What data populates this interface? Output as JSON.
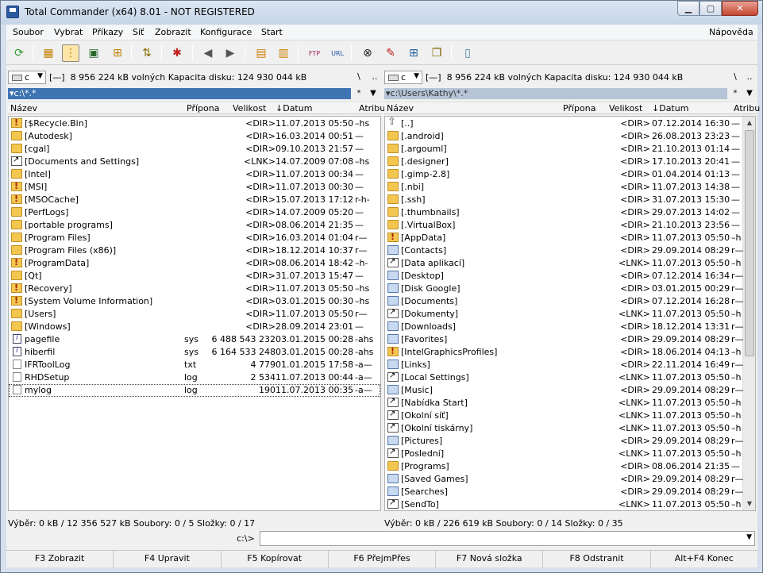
{
  "window": {
    "title": "Total Commander (x64) 8.01 - NOT REGISTERED"
  },
  "menu": [
    "Soubor",
    "Vybrat",
    "Příkazy",
    "Síť",
    "Zobrazit",
    "Konfigurace",
    "Start"
  ],
  "menu_help": "Nápověda",
  "toolbar_icons": [
    "refresh-icon",
    "brief-view-icon",
    "full-view-icon",
    "thumbnails-view-icon",
    "tree-view-icon",
    "invert-selection-icon",
    "compare-dirs-icon",
    "back-icon",
    "forward-icon",
    "pack-icon",
    "unpack-icon",
    "ftp-connect-icon",
    "url-connect-icon",
    "find-files-icon",
    "multi-rename-icon",
    "sync-dirs-icon",
    "copy-names-icon",
    "notepad-icon"
  ],
  "left": {
    "drive": "c",
    "drive_label": "[—]",
    "drive_info": "8 956 224 kB volných  Kapacita disku: 124 930 044 kB",
    "path": "c:\\*.*",
    "columns": {
      "name": "Název",
      "ext": "Přípona",
      "size": "Velikost",
      "date": "Datum",
      "attr": "Atribu"
    },
    "files": [
      {
        "icon": "folder-excl",
        "name": "[$Recycle.Bin]",
        "ext": "",
        "size": "<DIR>",
        "date": "11.07.2013 05:50",
        "attr": "–hs"
      },
      {
        "icon": "folder",
        "name": "[Autodesk]",
        "ext": "",
        "size": "<DIR>",
        "date": "16.03.2014 00:51",
        "attr": "—"
      },
      {
        "icon": "folder",
        "name": "[cgal]",
        "ext": "",
        "size": "<DIR>",
        "date": "09.10.2013 21:57",
        "attr": "—"
      },
      {
        "icon": "lnk",
        "name": "[Documents and Settings]",
        "ext": "",
        "size": "<LNK>",
        "date": "14.07.2009 07:08",
        "attr": "–hs"
      },
      {
        "icon": "folder",
        "name": "[Intel]",
        "ext": "",
        "size": "<DIR>",
        "date": "11.07.2013 00:34",
        "attr": "—"
      },
      {
        "icon": "folder-excl",
        "name": "[MSI]",
        "ext": "",
        "size": "<DIR>",
        "date": "11.07.2013 00:30",
        "attr": "—"
      },
      {
        "icon": "folder-excl",
        "name": "[MSOCache]",
        "ext": "",
        "size": "<DIR>",
        "date": "15.07.2013 17:12",
        "attr": "r-h-"
      },
      {
        "icon": "folder",
        "name": "[PerfLogs]",
        "ext": "",
        "size": "<DIR>",
        "date": "14.07.2009 05:20",
        "attr": "—"
      },
      {
        "icon": "folder",
        "name": "[portable programs]",
        "ext": "",
        "size": "<DIR>",
        "date": "08.06.2014 21:35",
        "attr": "—"
      },
      {
        "icon": "folder",
        "name": "[Program Files]",
        "ext": "",
        "size": "<DIR>",
        "date": "16.03.2014 01:04",
        "attr": "r—"
      },
      {
        "icon": "folder",
        "name": "[Program Files (x86)]",
        "ext": "",
        "size": "<DIR>",
        "date": "18.12.2014 10:37",
        "attr": "r—"
      },
      {
        "icon": "folder-excl",
        "name": "[ProgramData]",
        "ext": "",
        "size": "<DIR>",
        "date": "08.06.2014 18:42",
        "attr": "–h-"
      },
      {
        "icon": "folder",
        "name": "[Qt]",
        "ext": "",
        "size": "<DIR>",
        "date": "31.07.2013 15:47",
        "attr": "—"
      },
      {
        "icon": "folder-excl",
        "name": "[Recovery]",
        "ext": "",
        "size": "<DIR>",
        "date": "11.07.2013 05:50",
        "attr": "–hs"
      },
      {
        "icon": "folder-excl",
        "name": "[System Volume Information]",
        "ext": "",
        "size": "<DIR>",
        "date": "03.01.2015 00:30",
        "attr": "–hs"
      },
      {
        "icon": "folder",
        "name": "[Users]",
        "ext": "",
        "size": "<DIR>",
        "date": "11.07.2013 05:50",
        "attr": "r—"
      },
      {
        "icon": "folder",
        "name": "[Windows]",
        "ext": "",
        "size": "<DIR>",
        "date": "28.09.2014 23:01",
        "attr": "—"
      },
      {
        "icon": "sys",
        "name": "pagefile",
        "ext": "sys",
        "size": "6 488 543 232",
        "date": "03.01.2015 00:28",
        "attr": "-ahs"
      },
      {
        "icon": "sys",
        "name": "hiberfil",
        "ext": "sys",
        "size": "6 164 533 248",
        "date": "03.01.2015 00:28",
        "attr": "-ahs"
      },
      {
        "icon": "file",
        "name": "IFRToolLog",
        "ext": "txt",
        "size": "4 779",
        "date": "01.01.2015 17:58",
        "attr": "-a—"
      },
      {
        "icon": "file",
        "name": "RHDSetup",
        "ext": "log",
        "size": "2 534",
        "date": "11.07.2013 00:44",
        "attr": "-a—"
      },
      {
        "icon": "file",
        "name": "mylog",
        "ext": "log",
        "size": "190",
        "date": "11.07.2013 00:35",
        "attr": "-a—"
      }
    ],
    "status": "Výběr: 0 kB / 12 356 527 kB  Soubory: 0 / 5  Složky: 0 / 17"
  },
  "right": {
    "drive": "c",
    "drive_label": "[—]",
    "drive_info": "8 956 224 kB volných  Kapacita disku: 124 930 044 kB",
    "path": "c:\\Users\\Kathy\\*.*",
    "columns": {
      "name": "Název",
      "ext": "Přípona",
      "size": "Velikost",
      "date": "Datum",
      "attr": "Atribu"
    },
    "files": [
      {
        "icon": "up",
        "name": "[..]",
        "ext": "",
        "size": "<DIR>",
        "date": "07.12.2014 16:30",
        "attr": "—"
      },
      {
        "icon": "folder",
        "name": "[.android]",
        "ext": "",
        "size": "<DIR>",
        "date": "26.08.2013 23:23",
        "attr": "—"
      },
      {
        "icon": "folder",
        "name": "[.argouml]",
        "ext": "",
        "size": "<DIR>",
        "date": "21.10.2013 01:14",
        "attr": "—"
      },
      {
        "icon": "folder",
        "name": "[.designer]",
        "ext": "",
        "size": "<DIR>",
        "date": "17.10.2013 20:41",
        "attr": "—"
      },
      {
        "icon": "folder",
        "name": "[.gimp-2.8]",
        "ext": "",
        "size": "<DIR>",
        "date": "01.04.2014 01:13",
        "attr": "—"
      },
      {
        "icon": "folder",
        "name": "[.nbi]",
        "ext": "",
        "size": "<DIR>",
        "date": "11.07.2013 14:38",
        "attr": "—"
      },
      {
        "icon": "folder",
        "name": "[.ssh]",
        "ext": "",
        "size": "<DIR>",
        "date": "31.07.2013 15:30",
        "attr": "—"
      },
      {
        "icon": "folder",
        "name": "[.thumbnails]",
        "ext": "",
        "size": "<DIR>",
        "date": "29.07.2013 14:02",
        "attr": "—"
      },
      {
        "icon": "folder",
        "name": "[.VirtualBox]",
        "ext": "",
        "size": "<DIR>",
        "date": "21.10.2013 23:56",
        "attr": "—"
      },
      {
        "icon": "folder-excl",
        "name": "[AppData]",
        "ext": "",
        "size": "<DIR>",
        "date": "11.07.2013 05:50",
        "attr": "–h"
      },
      {
        "icon": "special",
        "name": "[Contacts]",
        "ext": "",
        "size": "<DIR>",
        "date": "29.09.2014 08:29",
        "attr": "r—"
      },
      {
        "icon": "lnk",
        "name": "[Data aplikací]",
        "ext": "",
        "size": "<LNK>",
        "date": "11.07.2013 05:50",
        "attr": "–h"
      },
      {
        "icon": "special",
        "name": "[Desktop]",
        "ext": "",
        "size": "<DIR>",
        "date": "07.12.2014 16:34",
        "attr": "r—"
      },
      {
        "icon": "special",
        "name": "[Disk Google]",
        "ext": "",
        "size": "<DIR>",
        "date": "03.01.2015 00:29",
        "attr": "r—"
      },
      {
        "icon": "special",
        "name": "[Documents]",
        "ext": "",
        "size": "<DIR>",
        "date": "07.12.2014 16:28",
        "attr": "r—"
      },
      {
        "icon": "lnk",
        "name": "[Dokumenty]",
        "ext": "",
        "size": "<LNK>",
        "date": "11.07.2013 05:50",
        "attr": "–h"
      },
      {
        "icon": "special",
        "name": "[Downloads]",
        "ext": "",
        "size": "<DIR>",
        "date": "18.12.2014 13:31",
        "attr": "r—"
      },
      {
        "icon": "special",
        "name": "[Favorites]",
        "ext": "",
        "size": "<DIR>",
        "date": "29.09.2014 08:29",
        "attr": "r—"
      },
      {
        "icon": "folder-excl",
        "name": "[IntelGraphicsProfiles]",
        "ext": "",
        "size": "<DIR>",
        "date": "18.06.2014 04:13",
        "attr": "–h"
      },
      {
        "icon": "special",
        "name": "[Links]",
        "ext": "",
        "size": "<DIR>",
        "date": "22.11.2014 16:49",
        "attr": "r—"
      },
      {
        "icon": "lnk",
        "name": "[Local Settings]",
        "ext": "",
        "size": "<LNK>",
        "date": "11.07.2013 05:50",
        "attr": "–h"
      },
      {
        "icon": "special",
        "name": "[Music]",
        "ext": "",
        "size": "<DIR>",
        "date": "29.09.2014 08:29",
        "attr": "r—"
      },
      {
        "icon": "lnk",
        "name": "[Nabídka Start]",
        "ext": "",
        "size": "<LNK>",
        "date": "11.07.2013 05:50",
        "attr": "–h"
      },
      {
        "icon": "lnk",
        "name": "[Okolní síť]",
        "ext": "",
        "size": "<LNK>",
        "date": "11.07.2013 05:50",
        "attr": "–h"
      },
      {
        "icon": "lnk",
        "name": "[Okolní tiskárny]",
        "ext": "",
        "size": "<LNK>",
        "date": "11.07.2013 05:50",
        "attr": "–h"
      },
      {
        "icon": "special",
        "name": "[Pictures]",
        "ext": "",
        "size": "<DIR>",
        "date": "29.09.2014 08:29",
        "attr": "r—"
      },
      {
        "icon": "lnk",
        "name": "[Poslední]",
        "ext": "",
        "size": "<LNK>",
        "date": "11.07.2013 05:50",
        "attr": "–h"
      },
      {
        "icon": "folder",
        "name": "[Programs]",
        "ext": "",
        "size": "<DIR>",
        "date": "08.06.2014 21:35",
        "attr": "—"
      },
      {
        "icon": "special",
        "name": "[Saved Games]",
        "ext": "",
        "size": "<DIR>",
        "date": "29.09.2014 08:29",
        "attr": "r—"
      },
      {
        "icon": "special",
        "name": "[Searches]",
        "ext": "",
        "size": "<DIR>",
        "date": "29.09.2014 08:29",
        "attr": "r—"
      },
      {
        "icon": "lnk",
        "name": "[SendTo]",
        "ext": "",
        "size": "<LNK>",
        "date": "11.07.2013 05:50",
        "attr": "–h"
      }
    ],
    "status": "Výběr: 0 kB / 226 619 kB  Soubory: 0 / 14  Složky: 0 / 35"
  },
  "cmdline": {
    "label": "c:\\>",
    "value": ""
  },
  "fkeys": [
    "F3 Zobrazit",
    "F4 Upravit",
    "F5 Kopírovat",
    "F6 PřejmPřes",
    "F7 Nová složka",
    "F8 Odstranit",
    "Alt+F4 Konec"
  ]
}
